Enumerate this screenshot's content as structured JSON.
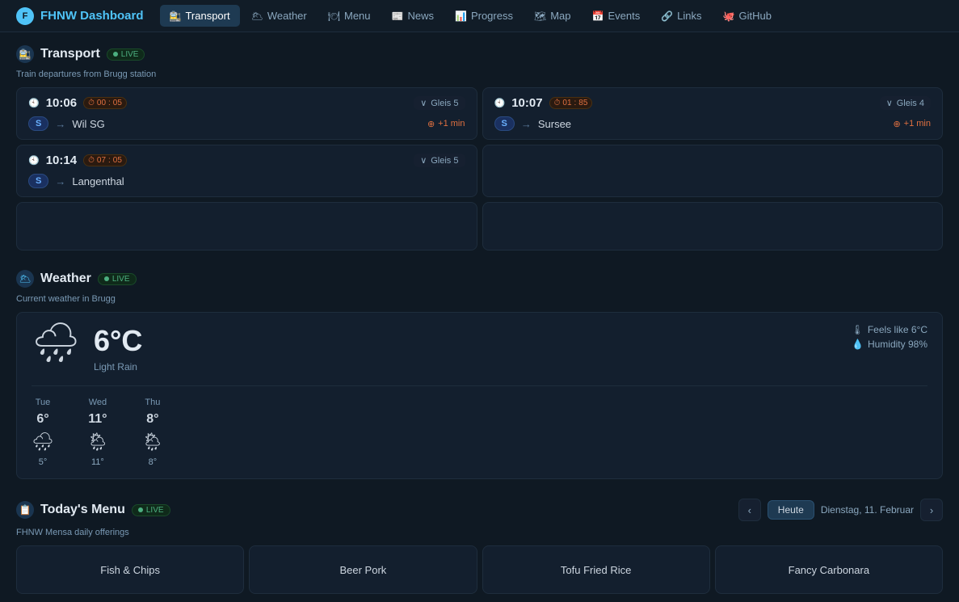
{
  "header": {
    "logo_text": "FHNW Dashboard",
    "nav_items": [
      {
        "id": "transport",
        "label": "Transport",
        "icon": "🚉",
        "active": true
      },
      {
        "id": "weather",
        "label": "Weather",
        "icon": "🌥"
      },
      {
        "id": "menu",
        "label": "Menu",
        "icon": "🍽"
      },
      {
        "id": "news",
        "label": "News",
        "icon": "📰"
      },
      {
        "id": "progress",
        "label": "Progress",
        "icon": "📊"
      },
      {
        "id": "map",
        "label": "Map",
        "icon": "🗺"
      },
      {
        "id": "events",
        "label": "Events",
        "icon": "📅"
      },
      {
        "id": "links",
        "label": "Links",
        "icon": "🔗"
      },
      {
        "id": "github",
        "label": "GitHub",
        "icon": "🐙"
      }
    ]
  },
  "transport": {
    "section_title": "Transport",
    "live_label": "LIVE",
    "subtitle": "Train departures from Brugg station",
    "departures": [
      {
        "time": "10:06",
        "delay_min": "00",
        "delay_sep": ":",
        "delay_badge": "05",
        "track": "Gleis 5",
        "train_type": "S",
        "destination": "Wil SG",
        "extra_delay": "+1 min"
      },
      {
        "time": "10:07",
        "delay_min": "01",
        "delay_sep": ":",
        "delay_badge": "85",
        "track": "Gleis 4",
        "train_type": "S",
        "destination": "Sursee",
        "extra_delay": "+1 min"
      },
      {
        "time": "10:14",
        "delay_min": "07",
        "delay_sep": ":",
        "delay_badge": "05",
        "track": "Gleis 5",
        "train_type": "S",
        "destination": "Langenthal",
        "extra_delay": ""
      }
    ]
  },
  "weather": {
    "section_title": "Weather",
    "live_label": "LIVE",
    "subtitle": "Current weather in Brugg",
    "temp": "6°C",
    "description": "Light Rain",
    "feels_like": "Feels like 6°C",
    "humidity": "Humidity 98%",
    "forecast": [
      {
        "day_label": "Tue",
        "day_num": "6°",
        "low": "5°",
        "icon": "🌧"
      },
      {
        "day_label": "Wed",
        "day_num": "11°",
        "low": "11°",
        "icon": "🌦"
      },
      {
        "day_label": "Thu",
        "day_num": "8°",
        "low": "8°",
        "icon": "🌦"
      }
    ]
  },
  "menu_section": {
    "section_title": "Today's Menu",
    "live_label": "LIVE",
    "subtitle": "FHNW Mensa daily offerings",
    "today_btn": "Heute",
    "date_label": "Dienstag, 11. Februar",
    "items": [
      {
        "name": "Fish & Chips"
      },
      {
        "name": "Beer Pork"
      },
      {
        "name": "Tofu Fried Rice"
      },
      {
        "name": "Fancy Carbonara"
      }
    ]
  }
}
